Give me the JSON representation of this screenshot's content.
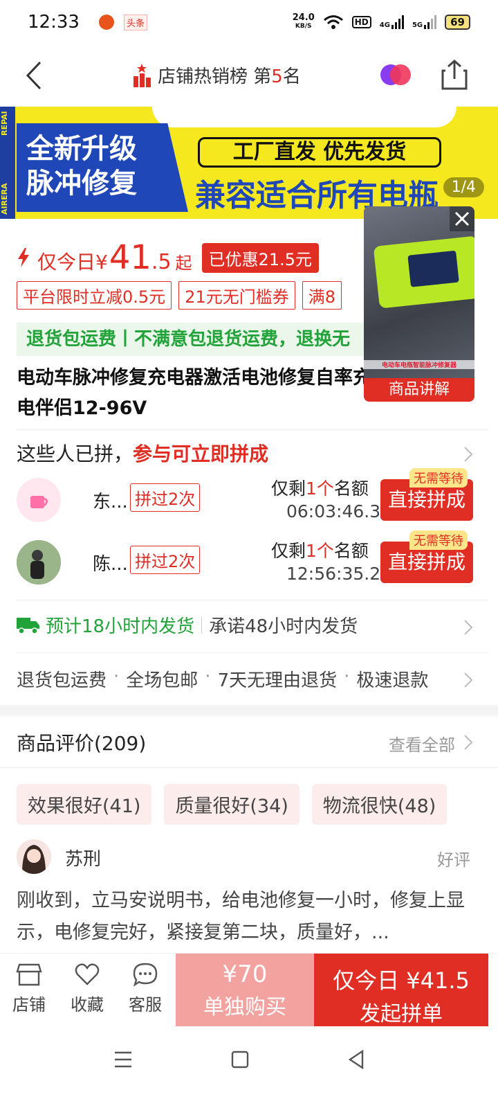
{
  "status_bar": {
    "time": "12:33",
    "app_tag": "头条",
    "net_speed_value": "24.0",
    "net_speed_unit": "KB/S",
    "hd_label": "HD",
    "signal_1": "4G",
    "signal_2": "5G",
    "battery": "69"
  },
  "nav": {
    "rank_label": "店铺热销榜 第",
    "rank_number": "5",
    "rank_suffix": "名"
  },
  "banner": {
    "side_top": "REPAI",
    "side_bottom": "AIRERA",
    "headline_1": "全新升级",
    "headline_2": "脉冲修复",
    "box_text": "工厂直发 优先发货",
    "big_text": "兼容适合所有电瓶",
    "counter": "1/4"
  },
  "price": {
    "label": "仅今日",
    "currency": "¥",
    "integer": "41",
    "decimal": ".5",
    "suffix": "起",
    "discount": "已优惠21.5元"
  },
  "coupons": [
    "平台限时立减0.5元",
    "21元无门槛券",
    "满8"
  ],
  "green_banner": "退货包运费丨不满意包退货运费，退换无",
  "product_title": "电动车脉冲修复充电器激活电池修复自率充电伴侣12-96V",
  "video": {
    "label": "商品讲解",
    "caption": "电动车电瓶智能脉冲修复器"
  },
  "group_section": {
    "heading": "这些人已拼，",
    "heading_red": "参与可立即拼成",
    "rows": [
      {
        "name": "东...",
        "count": "拼过2次",
        "remain_pre": "仅剩",
        "remain_num": "1个",
        "remain_post": "名额",
        "timer": "06:03:46.3",
        "tag": "无需等待",
        "button": "直接拼成"
      },
      {
        "name": "陈...",
        "count": "拼过2次",
        "remain_pre": "仅剩",
        "remain_num": "1个",
        "remain_post": "名额",
        "timer": "12:56:35.2",
        "tag": "无需等待",
        "button": "直接拼成"
      }
    ]
  },
  "shipping": {
    "estimate": "预计18小时内发货",
    "promise": "承诺48小时内发货"
  },
  "services": [
    "退货包运费",
    "全场包邮",
    "7天无理由退货",
    "极速退款"
  ],
  "reviews": {
    "heading": "商品评价(209)",
    "see_all": "查看全部",
    "tags": [
      "效果很好(41)",
      "质量很好(34)",
      "物流很快(48)"
    ],
    "reviewer": "苏刑",
    "rating": "好评",
    "text": "刚收到，立马安说明书，给电池修复一小时，修复上显示，电修复完好，紧接复第二块，质量好，..."
  },
  "bottom_bar": {
    "shop": "店铺",
    "favorite": "收藏",
    "service": "客服",
    "solo_price": "¥70",
    "solo_label": "单独购买",
    "group_price": "仅今日 ¥41.5",
    "group_label": "发起拼单"
  },
  "colors": {
    "brand_red": "#e02e24",
    "green": "#22a33a",
    "banner_yellow": "#f5e81e",
    "banner_blue": "#1f47b8"
  }
}
